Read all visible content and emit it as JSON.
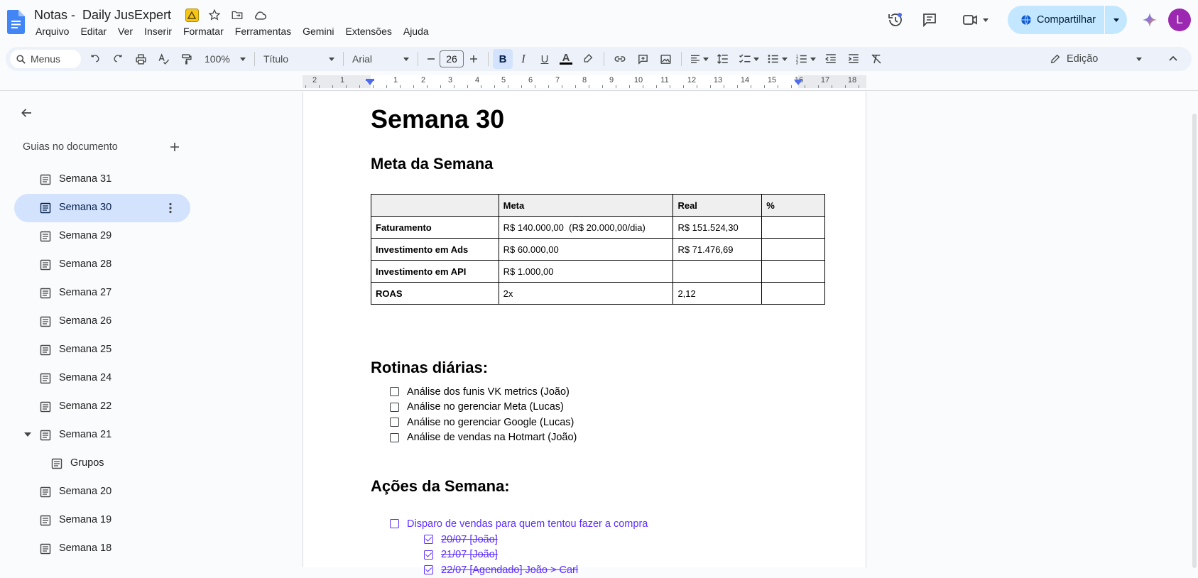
{
  "app": {
    "doc_title": "Notas -  Daily JusExpert",
    "menu": [
      "Arquivo",
      "Editar",
      "Ver",
      "Inserir",
      "Formatar",
      "Ferramentas",
      "Gemini",
      "Extensões",
      "Ajuda"
    ],
    "share_label": "Compartilhar",
    "avatar_letter": "L",
    "colors": {
      "share_bg": "#c2e7ff",
      "active_item_bg": "#d3e3fd",
      "avatar_bg": "#9c27b0",
      "checklist_purple": "#5b2dff",
      "docs_blue": "#4285f4"
    }
  },
  "toolbar": {
    "search_placeholder": "Menus",
    "zoom": "100%",
    "style": "Título",
    "font": "Arial",
    "font_size": "26",
    "mode": "Edição",
    "icons": [
      "undo-icon",
      "redo-icon",
      "print-icon",
      "spellcheck-icon",
      "paint-format-icon",
      "bold-icon",
      "italic-icon",
      "underline-icon",
      "text-color-icon",
      "highlight-icon",
      "link-icon",
      "comment-icon",
      "image-icon",
      "align-icon",
      "line-spacing-icon",
      "checklist-icon",
      "bullet-list-icon",
      "numbered-list-icon",
      "indent-decrease-icon",
      "indent-increase-icon",
      "clear-format-icon"
    ]
  },
  "ruler": {
    "labels": [
      "2",
      "1",
      "1",
      "2",
      "3",
      "4",
      "5",
      "6",
      "7",
      "8",
      "9",
      "10",
      "11",
      "12",
      "13",
      "14",
      "15",
      "16",
      "17",
      "18"
    ]
  },
  "sidebar": {
    "header": "Guias no documento",
    "items": [
      {
        "label": "Semana 31",
        "active": false,
        "child": false,
        "expanded": false
      },
      {
        "label": "Semana 30",
        "active": true,
        "child": false,
        "expanded": false
      },
      {
        "label": "Semana 29",
        "active": false,
        "child": false,
        "expanded": false
      },
      {
        "label": "Semana 28",
        "active": false,
        "child": false,
        "expanded": false
      },
      {
        "label": "Semana 27",
        "active": false,
        "child": false,
        "expanded": false
      },
      {
        "label": "Semana 26",
        "active": false,
        "child": false,
        "expanded": false
      },
      {
        "label": "Semana 25",
        "active": false,
        "child": false,
        "expanded": false
      },
      {
        "label": "Semana 24",
        "active": false,
        "child": false,
        "expanded": false
      },
      {
        "label": "Semana 22",
        "active": false,
        "child": false,
        "expanded": false
      },
      {
        "label": "Semana 21",
        "active": false,
        "child": false,
        "expanded": true
      },
      {
        "label": "Grupos",
        "active": false,
        "child": true,
        "expanded": false
      },
      {
        "label": "Semana 20",
        "active": false,
        "child": false,
        "expanded": false
      },
      {
        "label": "Semana 19",
        "active": false,
        "child": false,
        "expanded": false
      },
      {
        "label": "Semana 18",
        "active": false,
        "child": false,
        "expanded": false
      }
    ]
  },
  "document": {
    "title": "Semana 30",
    "goal_heading": "Meta da Semana",
    "table": {
      "headers": [
        "",
        "Meta",
        "Real",
        "%"
      ],
      "rows": [
        [
          "Faturamento",
          "R$ 140.000,00  (R$ 20.000,00/dia)",
          "R$ 151.524,30",
          ""
        ],
        [
          "Investimento em Ads",
          "R$ 60.000,00",
          "R$ 71.476,69",
          ""
        ],
        [
          "Investimento em API",
          "R$ 1.000,00",
          "",
          ""
        ],
        [
          "ROAS",
          "2x",
          "2,12",
          ""
        ]
      ]
    },
    "routines_heading": "Rotinas diárias:",
    "routines": [
      "Análise dos funis VK metrics (João)",
      "Análise no gerenciar Meta (Lucas)",
      "Análise no gerenciar Google (Lucas)",
      "Análise de vendas na Hotmart (João)"
    ],
    "actions_heading": "Ações da Semana:",
    "action_main": "Disparo de vendas para quem tentou fazer a compra",
    "action_subs": [
      {
        "text": "20/07 [João]",
        "checked": true
      },
      {
        "text": "21/07  [João]",
        "checked": true
      },
      {
        "text": "22/07 [Agendado] João > Carl",
        "checked": true
      }
    ]
  }
}
